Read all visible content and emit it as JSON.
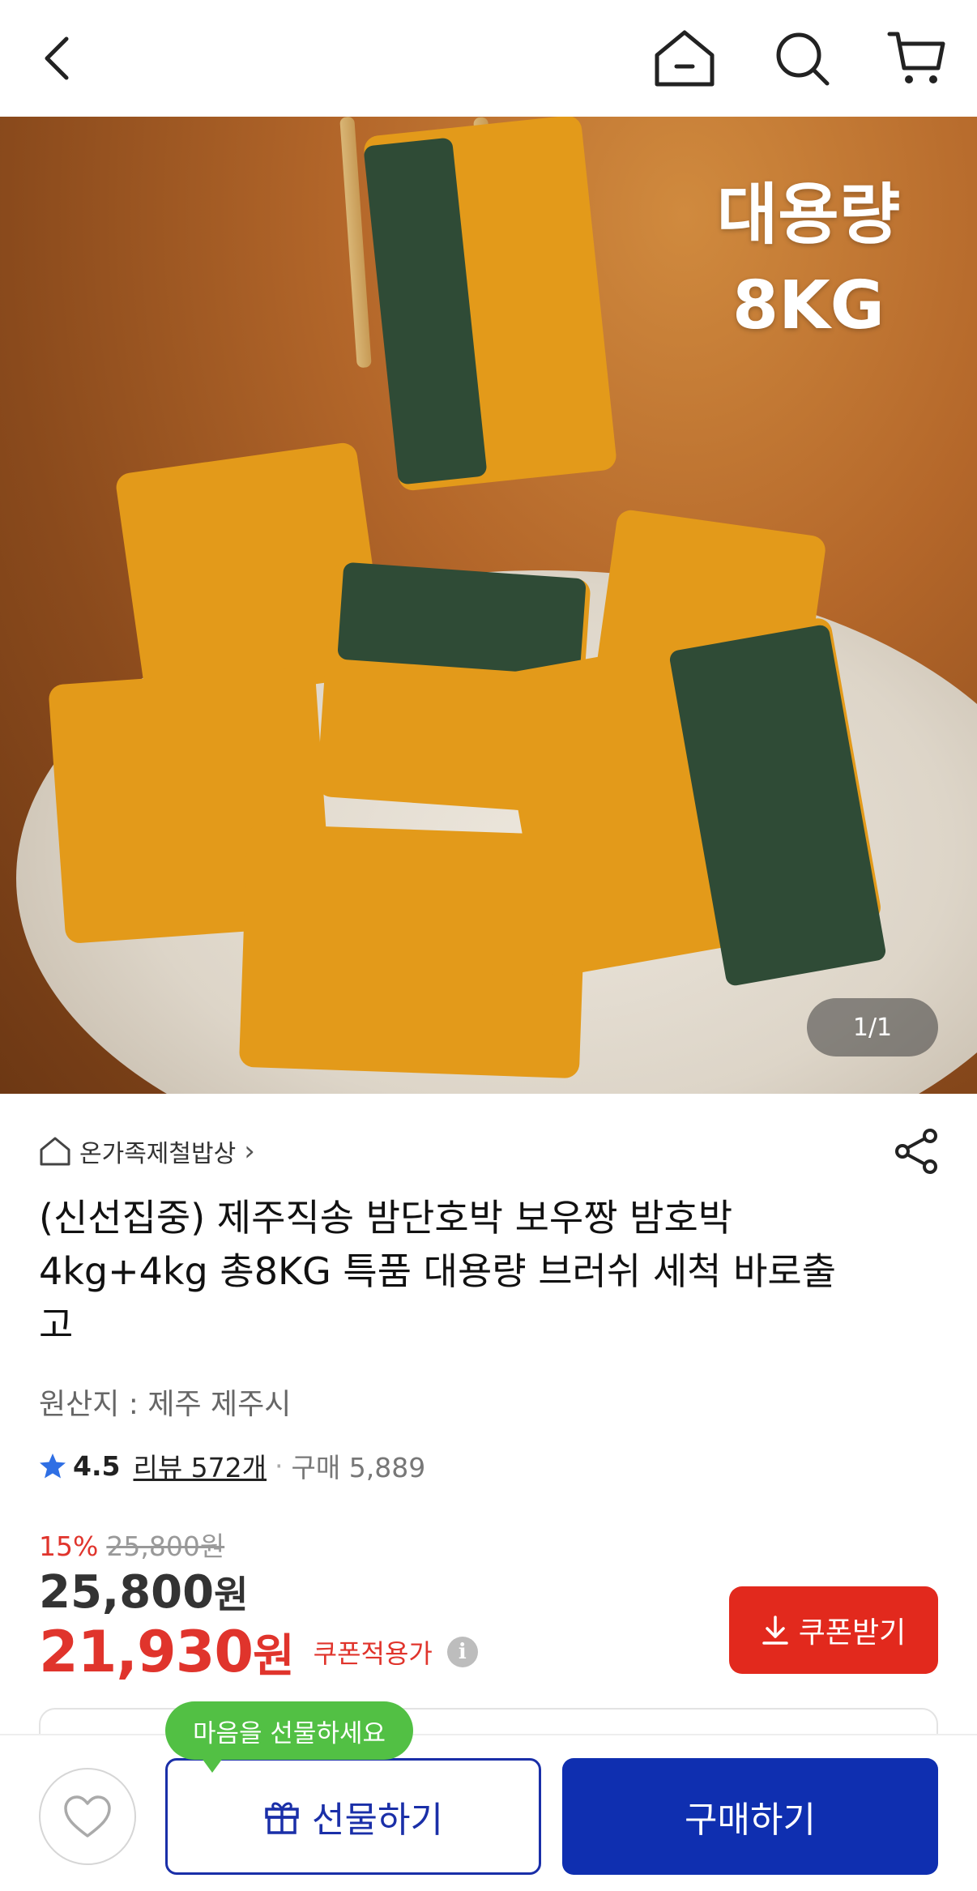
{
  "header": {
    "back_icon": "chevron-left-icon",
    "home_icon": "home-icon",
    "search_icon": "search-icon",
    "cart_icon": "cart-icon"
  },
  "hero": {
    "overlay_line1": "대용량",
    "overlay_line2": "8KG",
    "counter": "1/1"
  },
  "store": {
    "name": "온가족제철밥상",
    "chevron": "›"
  },
  "product": {
    "title": "(신선집중) 제주직송 밤단호박 보우짱 밤호박 4kg+4kg 총8KG 특품 대용량 브러쉬 세척 바로출고",
    "origin": "원산지 : 제주 제주시",
    "rating": "4.5",
    "reviews": "리뷰 572개",
    "dot": "·",
    "purchases": "구매 5,889"
  },
  "pricing": {
    "discount_pct": "15%",
    "original_price": "25,800원",
    "price_number": "25,800",
    "price_unit": "원",
    "coupon_price_number": "21,930",
    "coupon_price_unit": "원",
    "coupon_price_label": "쿠폰적용가",
    "info_icon_glyph": "i",
    "coupon_button_label": "쿠폰받기"
  },
  "bottom": {
    "tooltip": "마음을 선물하세요",
    "gift_label": "선물하기",
    "buy_label": "구매하기"
  },
  "colors": {
    "accent_red": "#e2291d",
    "primary_blue": "#0f2fb0",
    "tooltip_green": "#52c044"
  }
}
